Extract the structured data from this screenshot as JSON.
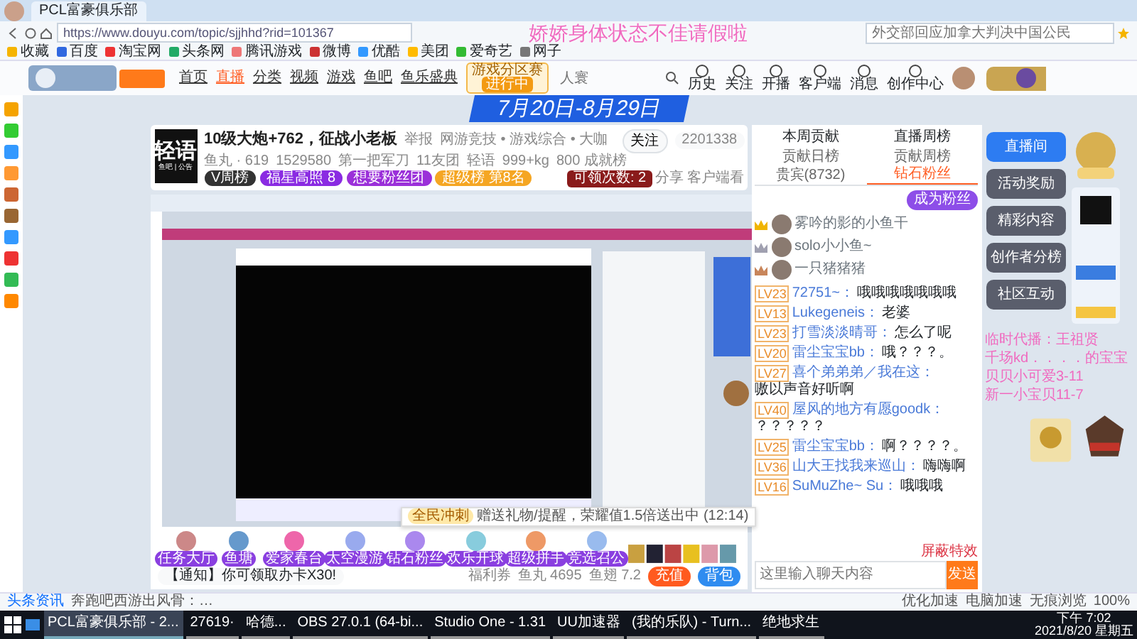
{
  "browser": {
    "tab_title": "PCL富豪俱乐部",
    "url": "https://www.douyu.com/topic/sjjhhd?rid=101367",
    "search_placeholder": "外交部回应加拿大判决中国公民",
    "bookmarks": [
      "收藏",
      "百度",
      "淘宝网",
      "头条网",
      "腾讯游戏",
      "微博",
      "优酷",
      "美团",
      "爱奇艺",
      "网子"
    ]
  },
  "overlay_top": "娇娇身体状态不佳请假啦",
  "overlay_side": [
    "临时代播：王祖贤",
    "千场kd．．．．的宝宝",
    "贝贝小可爱3-11",
    "新一小宝贝11-7"
  ],
  "site_nav": {
    "items": [
      {
        "label": "首页",
        "selected": false
      },
      {
        "label": "直播",
        "selected": true
      },
      {
        "label": "分类",
        "selected": false
      },
      {
        "label": "视频",
        "selected": false
      },
      {
        "label": "游戏",
        "selected": false
      },
      {
        "label": "鱼吧",
        "selected": false
      },
      {
        "label": "鱼乐盛典",
        "selected": false
      }
    ],
    "event_badge": "游戏分区赛",
    "event_state": "进行中",
    "search_placeholder": "人寰",
    "icons": [
      {
        "label": "历史"
      },
      {
        "label": "关注"
      },
      {
        "label": "开播"
      },
      {
        "label": "客户端"
      },
      {
        "label": "消息"
      },
      {
        "label": "创作中心"
      }
    ]
  },
  "banner": {
    "dates": "7月20日-8月29日"
  },
  "room": {
    "logo": "轻语",
    "logo_sub": "鱼吧 | 公告",
    "title": "10级大炮+762，征战小老板",
    "report": "举报",
    "category": "网游竞技 • 游戏综合 • 大咖",
    "follow": "关注",
    "followers": "2201338",
    "stats": [
      "鱼丸 · 619",
      "1529580",
      "第一把军刀",
      "11友团",
      "轻语",
      "999+kg",
      "800 成就榜"
    ],
    "badges": [
      {
        "label": "V周榜",
        "color": "#333333"
      },
      {
        "label": "福星高照 8",
        "color": "#8a2be2"
      },
      {
        "label": "想要粉丝团",
        "color": "#9b30d9"
      },
      {
        "label": "超级榜 第8名",
        "color": "#f5a623"
      }
    ],
    "claim": "可领次数: 2",
    "share": "分享",
    "client": "客户端看"
  },
  "gifts": [
    {
      "label": "任务大厅"
    },
    {
      "label": "鱼塘"
    },
    {
      "label": "爱家春台"
    },
    {
      "label": "太空漫游"
    },
    {
      "label": "钻石粉丝"
    },
    {
      "label": "欢乐开球"
    },
    {
      "label": "超级拼手"
    },
    {
      "label": "竞选召公"
    }
  ],
  "gift_popup": {
    "tag": "全民冲刺",
    "text": "赠送礼物/提醒，荣耀值1.5倍送出中 (12:14)"
  },
  "notice": "【通知】你可领取办卡X30!",
  "wallet": {
    "coupons": "福利券",
    "fish_balls": "鱼丸 4695",
    "fish_fins": "鱼翅 7.2",
    "recharge": "充值",
    "backpack": "背包"
  },
  "chat": {
    "top_tabs": [
      "本周贡献",
      "直播周榜"
    ],
    "tabs": [
      {
        "label": "贡献日榜",
        "selected": false
      },
      {
        "label": "贡献周榜",
        "selected": false
      },
      {
        "label": "贵宾(8732)",
        "selected": false
      },
      {
        "label": "钻石粉丝",
        "selected": true
      }
    ],
    "promo": "成为粉丝",
    "ranks": [
      {
        "name": "雾吟的影的小鱼干",
        "color": "#f0b400"
      },
      {
        "name": "solo小小鱼~",
        "color": "#a0a0b0"
      },
      {
        "name": "一只猪猪猪",
        "color": "#c8855a"
      }
    ],
    "messages": [
      {
        "level": "LV23",
        "user": "72751~：",
        "text": "哦哦哦哦哦哦哦"
      },
      {
        "level": "LV13",
        "user": "Lukegeneis：",
        "text": "老婆"
      },
      {
        "level": "LV23",
        "user": "打雪淡淡晴哥：",
        "text": "怎么了呢"
      },
      {
        "level": "LV20",
        "user": "雷尘宝宝bb：",
        "text": "哦？？？。"
      },
      {
        "level": "LV27",
        "user": "喜个弟弟弟／我在这：",
        "text": "嗷以声音好听啊"
      },
      {
        "level": "LV40",
        "user": "屋风的地方有愿goodk：",
        "text": "？？？？？"
      },
      {
        "level": "LV25",
        "user": "雷尘宝宝bb：",
        "text": "啊？？？？。"
      },
      {
        "level": "LV36",
        "user": "山大王找我来巡山：",
        "text": "嗨嗨啊"
      },
      {
        "level": "LV16",
        "user": "SuMuZhe~ Su：",
        "text": "哦哦哦"
      }
    ],
    "block": "屏蔽特效",
    "input_placeholder": "这里输入聊天内容",
    "send": "发送"
  },
  "side_buttons": [
    {
      "label": "直播间",
      "selected": true
    },
    {
      "label": "活动奖励",
      "selected": false
    },
    {
      "label": "精彩内容",
      "selected": false
    },
    {
      "label": "创作者分榜",
      "selected": false
    },
    {
      "label": "社区互动",
      "selected": false
    }
  ],
  "status_bar": {
    "news": "头条资讯",
    "headline": "奔跑吧西游出风骨：…",
    "tools": [
      "优化加速",
      "电脑加速",
      "无痕浏览",
      "100%"
    ]
  },
  "taskbar": {
    "apps": [
      {
        "label": "PCL富豪俱乐部 - 2...",
        "selected": true
      },
      {
        "label": "27619·",
        "selected": false
      },
      {
        "label": "哈德...",
        "selected": false
      },
      {
        "label": "OBS 27.0.1 (64-bi...",
        "selected": false
      },
      {
        "label": "Studio One - 1.31",
        "selected": false
      },
      {
        "label": "UU加速器",
        "selected": false
      },
      {
        "label": "(我的乐队) - Turn...",
        "selected": false
      },
      {
        "label": "绝地求生",
        "selected": false
      }
    ],
    "time": "下午 7:02",
    "date": "2021/8/20 星期五"
  }
}
